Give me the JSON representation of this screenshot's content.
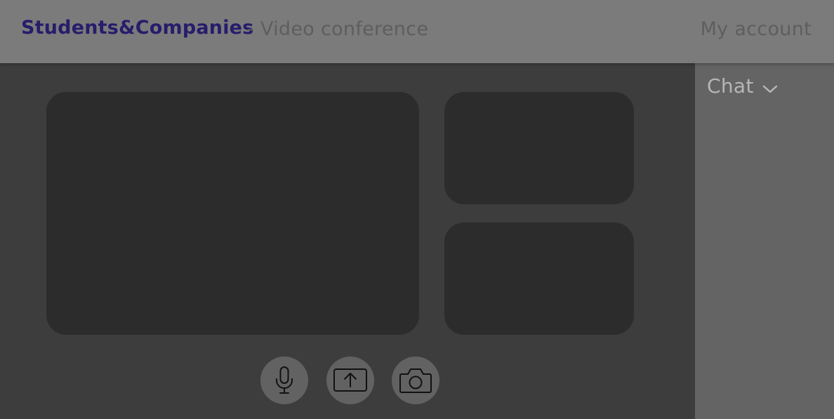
{
  "header": {
    "brand": "Students&Companies",
    "subtitle": "- Video conference",
    "account_link": "My account"
  },
  "video_grid": {
    "tiles": [
      "main-participant",
      "participant-2",
      "participant-3"
    ]
  },
  "controls": {
    "buttons": [
      {
        "name": "microphone",
        "icon": "microphone-icon"
      },
      {
        "name": "share-screen",
        "icon": "share-screen-icon"
      },
      {
        "name": "camera",
        "icon": "camera-icon"
      }
    ]
  },
  "sidebar": {
    "chat_title": "Chat",
    "chat_icon": "chevron-down-icon"
  },
  "colors": {
    "brand": "#261d6b",
    "header_bg": "#7b7b7b",
    "main_bg": "#3d3d3d",
    "tile_bg": "#2c2c2c",
    "sidebar_bg": "#646464",
    "control_bg": "#626262"
  }
}
